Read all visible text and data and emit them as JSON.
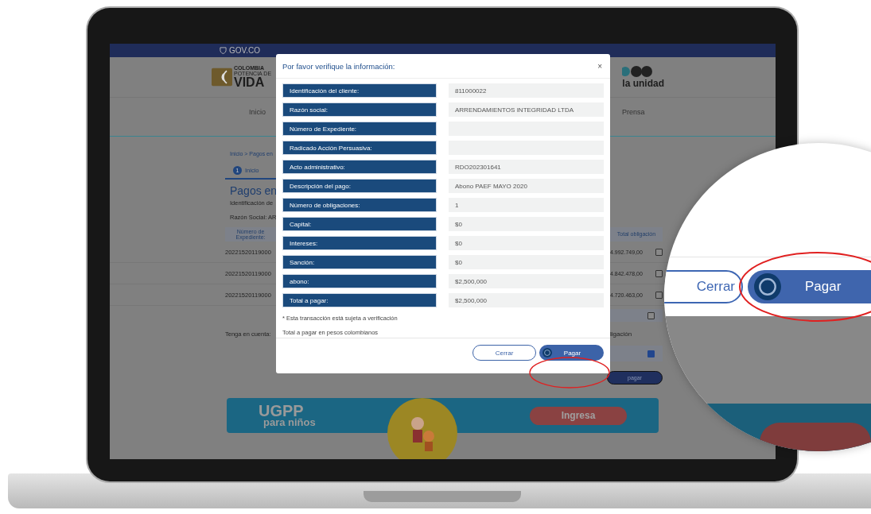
{
  "gov_bar": {
    "label": "GOV.CO"
  },
  "header": {
    "logo_lines": [
      "COLOMBIA",
      "POTENCIA DE",
      "VIDA"
    ],
    "partner_logo": "la unidad"
  },
  "nav": [
    "Inicio",
    "Prensa"
  ],
  "breadcrumb": "Inicio > Pagos en",
  "step": {
    "number": "1",
    "label": "Inicio",
    "selected": true
  },
  "page": {
    "heading": "Pagos en",
    "lines": [
      "Identificación de",
      "Razón Social: AR"
    ]
  },
  "table": {
    "left_header": "Número de Expediente:",
    "right_header": "Total obligación",
    "rows": [
      {
        "expediente": "20221520119000",
        "total": "4.992.749,00",
        "checked": false
      },
      {
        "expediente": "20221520119000",
        "total": "4.842.478,00",
        "checked": false
      },
      {
        "expediente": "20221520119000",
        "total": "4.720.463,00",
        "checked": false
      }
    ],
    "total_row": {
      "checked": false
    }
  },
  "note_label": "Tenga en cuenta:",
  "right_label": "ligación",
  "selected_row": {
    "checked": true
  },
  "pay_button": "pagar",
  "banner": {
    "title": "UGPP",
    "subtitle": "para niños",
    "button": "Ingresa"
  },
  "modal": {
    "title": "Por favor verifique la información:",
    "close": "×",
    "fields": [
      {
        "label": "Identificación del cliente:",
        "value": "811000022"
      },
      {
        "label": "Razón social:",
        "value": "ARRENDAMIENTOS INTEGRIDAD LTDA"
      },
      {
        "label": "Número de Expediente:"
      },
      {
        "label": "Radicado Acción Persuasiva:"
      },
      {
        "label": "Acto administrativo:",
        "value": "RDO202301641"
      },
      {
        "label": "Descripción del pago:",
        "value": "Abono PAEF MAYO 2020"
      },
      {
        "label": "Número de obligaciones:",
        "value": "1"
      },
      {
        "label": "Capital:",
        "value": "$0"
      },
      {
        "label": "Intereses:",
        "value": "$0"
      },
      {
        "label": "Sanción:",
        "value": "$0"
      },
      {
        "label": "abono:",
        "value": "$2,500,000"
      },
      {
        "label": "Total a pagar:",
        "value": "$2,500,000"
      }
    ],
    "notes": [
      "* Esta transacción está sujeta a verificación",
      "Total a pagar en pesos colombianos"
    ],
    "cancel": "Cerrar",
    "pay": "Pagar"
  },
  "magnifier": {
    "cancel": "Cerrar",
    "pay": "Pagar"
  }
}
